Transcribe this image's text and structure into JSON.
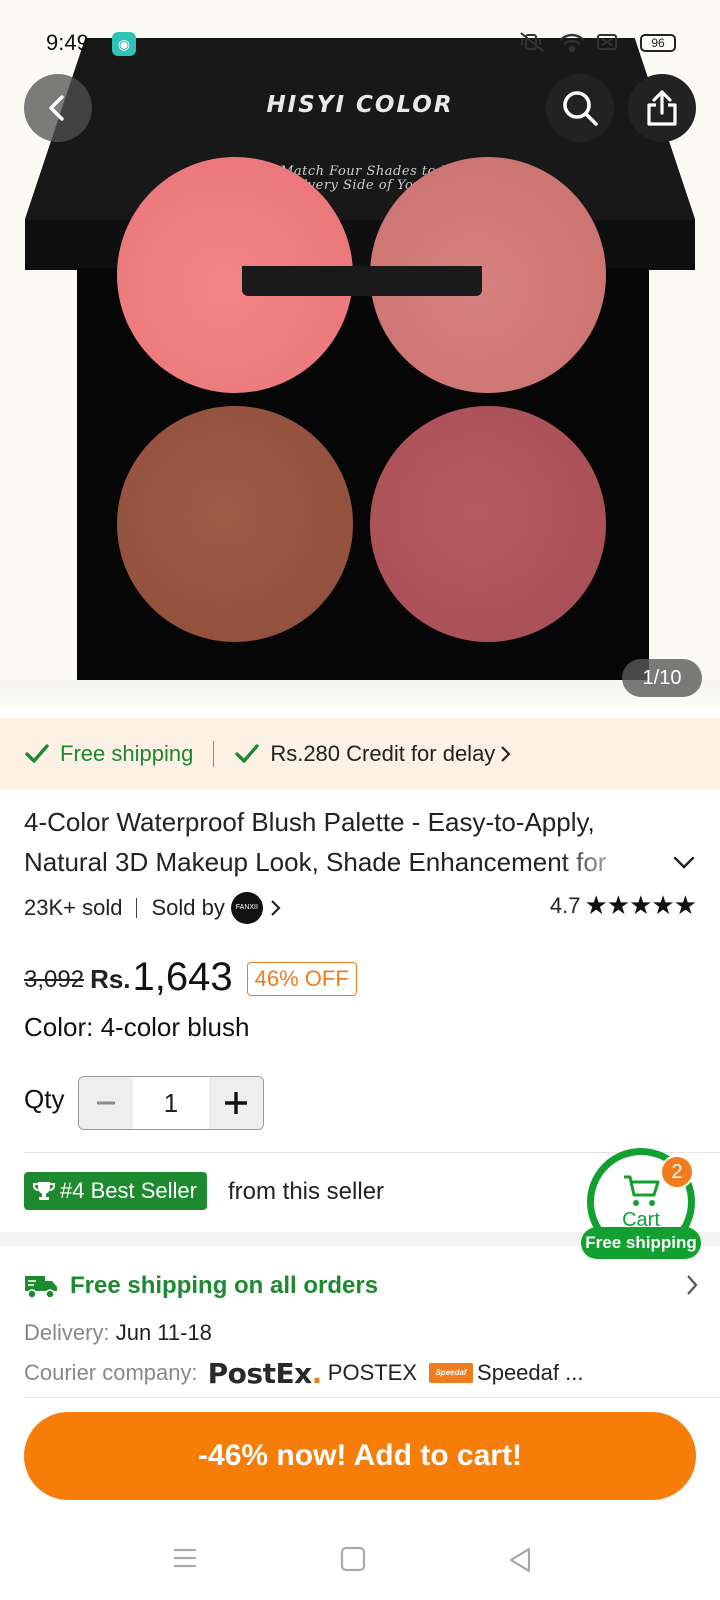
{
  "status_bar": {
    "time": "9:49",
    "battery": "96"
  },
  "hero": {
    "brand": "HISYI COLOR",
    "tagline_line1": "Mix and Match Four Shades to Enhance",
    "tagline_line2": "Every Side of You",
    "image_counter": "1/10",
    "pan_colors": [
      "#f38587",
      "#d6827f",
      "#9e5c47",
      "#b55b60"
    ]
  },
  "shipping_strip": {
    "free_shipping": "Free shipping",
    "credit": "Rs.280 Credit for delay"
  },
  "product": {
    "title": "4-Color Waterproof Blush Palette - Easy-to-Apply, Natural 3D Makeup Look, Shade Enhancement for",
    "sold": "23K+ sold",
    "sold_by": "Sold by",
    "seller_logo_text": "FANXII",
    "rating": "4.7",
    "stars": "★★★★★",
    "old_price": "3,092",
    "currency": "Rs.",
    "price": "1,643",
    "discount": "46% OFF",
    "color_label": "Color: 4-color blush"
  },
  "qty": {
    "label": "Qty",
    "value": "1"
  },
  "best_seller": {
    "badge": "#4 Best Seller",
    "suffix": "from this seller"
  },
  "cart_float": {
    "label": "Cart",
    "count": "2",
    "free_shipping": "Free shipping"
  },
  "delivery_info": {
    "free_shipping_all": "Free shipping on all orders",
    "delivery_key": "Delivery:",
    "delivery_value": "Jun 11-18",
    "courier_key": "Courier company:",
    "postex_logo": "PostEx",
    "postex_name": "POSTEX",
    "speedaf_logo": "Speedaf express",
    "speedaf_name": "Speedaf ..."
  },
  "cta": {
    "add_to_cart": "-46% now! Add to cart!"
  },
  "colors": {
    "brand_orange": "#f77d09",
    "green": "#1d8a2f",
    "discount_orange": "#f07c1e",
    "strip_bg": "#fdf0e4"
  }
}
